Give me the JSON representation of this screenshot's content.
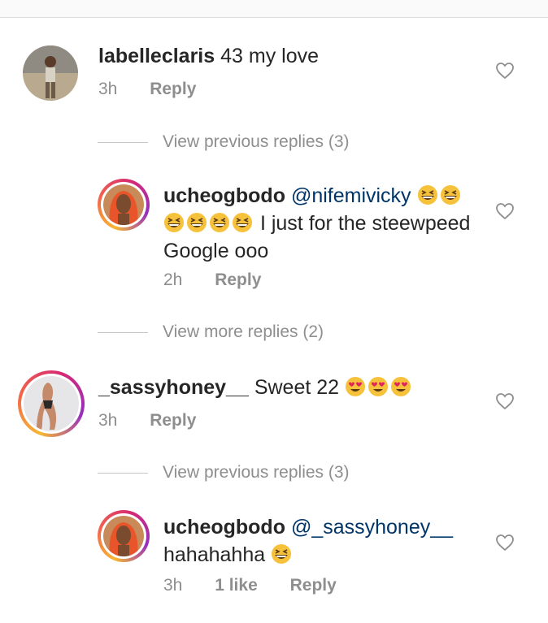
{
  "comments": [
    {
      "username": "labelleclaris",
      "mention": "",
      "text": "43 my love",
      "time": "3h",
      "likes": "",
      "reply": "Reply"
    },
    {
      "username": "ucheogbodo",
      "mention": "@nifemivicky",
      "text_line1_after": "",
      "text_line2": "I just for the steewpeed",
      "text_line3": "Google ooo",
      "time": "2h",
      "likes": "",
      "reply": "Reply"
    },
    {
      "username": "_sassyhoney__",
      "mention": "",
      "text": "Sweet 22",
      "time": "3h",
      "likes": "",
      "reply": "Reply"
    },
    {
      "username": "ucheogbodo",
      "mention": "@_sassyhoney__",
      "text_line2": "hahahahha",
      "time": "3h",
      "likes": "1 like",
      "reply": "Reply"
    }
  ],
  "view_replies": [
    "View previous replies (3)",
    "View more replies (2)",
    "View previous replies (3)"
  ],
  "colors": {
    "text": "#262626",
    "meta": "#8e8e8e",
    "mention": "#003569",
    "ring_start": "#f7b733",
    "ring_end": "#962fbf"
  },
  "icons": [
    "heart-outline-icon",
    "grinning-squinting-face-emoji",
    "heart-eyes-emoji"
  ]
}
